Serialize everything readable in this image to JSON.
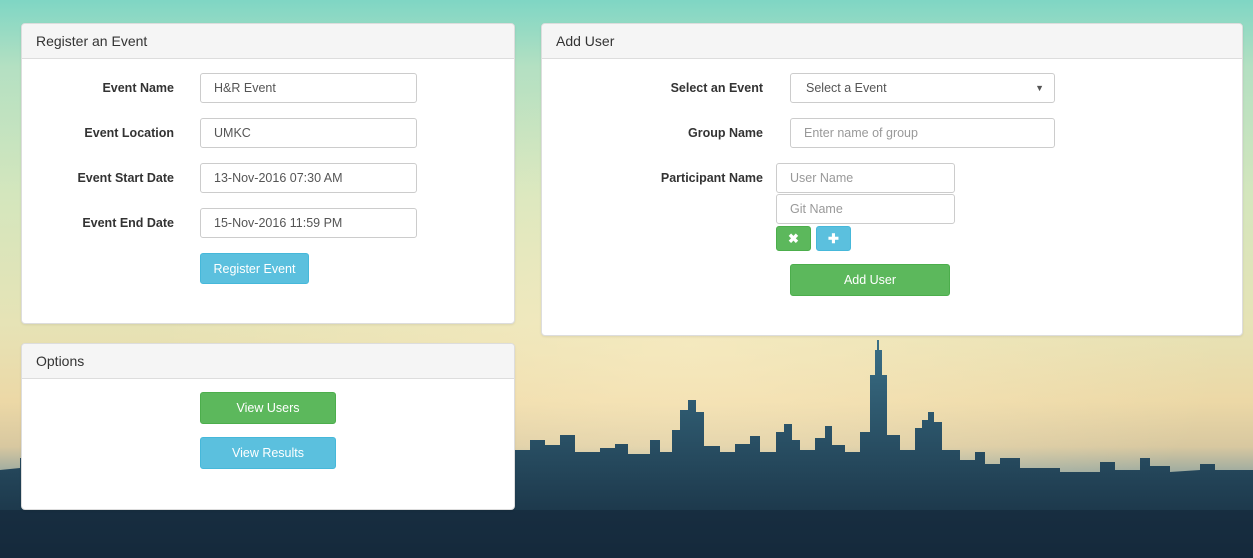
{
  "register": {
    "title": "Register an Event",
    "event_name_label": "Event Name",
    "event_name_value": "H&R Event",
    "event_location_label": "Event Location",
    "event_location_value": "UMKC",
    "start_date_label": "Event Start Date",
    "start_date_value": "13-Nov-2016 07:30 AM",
    "end_date_label": "Event End Date",
    "end_date_value": "15-Nov-2016 11:59 PM",
    "submit_label": "Register Event"
  },
  "add_user": {
    "title": "Add User",
    "select_event_label": "Select an Event",
    "select_event_value": "Select a Event",
    "group_name_label": "Group Name",
    "group_name_placeholder": "Enter name of group",
    "participant_label": "Participant Name",
    "user_name_placeholder": "User Name",
    "git_name_placeholder": "Git Name",
    "remove_icon": "✖",
    "add_icon": "✚",
    "submit_label": "Add User"
  },
  "options": {
    "title": "Options",
    "view_users_label": "View Users",
    "view_results_label": "View Results"
  },
  "colors": {
    "info": "#5bc0de",
    "success": "#5cb85c"
  }
}
